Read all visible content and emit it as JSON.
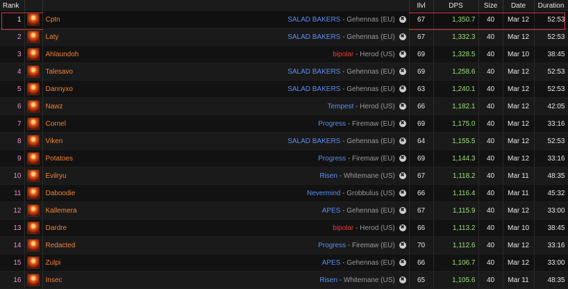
{
  "headers": {
    "rank": "Rank",
    "ilvl": "Ilvl",
    "dps": "DPS",
    "size": "Size",
    "date": "Date",
    "duration": "Duration"
  },
  "colors": {
    "accent_highlight": "#d93b3b",
    "player_name": "#f0823a",
    "dps": "#9be17a",
    "rank": "#e98fd0"
  },
  "rows": [
    {
      "rank": "1",
      "name": "Cptn",
      "guild": "SALAD BAKERS",
      "guild_color": "#5b8ef0",
      "realm": "Gehennas (EU)",
      "ilvl": "67",
      "dps": "1,350.7",
      "size": "40",
      "date": "Mar 12",
      "duration": "52:53"
    },
    {
      "rank": "2",
      "name": "Laty",
      "guild": "SALAD BAKERS",
      "guild_color": "#5b8ef0",
      "realm": "Gehennas (EU)",
      "ilvl": "67",
      "dps": "1,332.3",
      "size": "40",
      "date": "Mar 12",
      "duration": "52:53"
    },
    {
      "rank": "3",
      "name": "Ahlaundoh",
      "guild": "bipolar",
      "guild_color": "#e83a3a",
      "realm": "Herod (US)",
      "ilvl": "69",
      "dps": "1,328.5",
      "size": "40",
      "date": "Mar 10",
      "duration": "38:45"
    },
    {
      "rank": "4",
      "name": "Talesavo",
      "guild": "SALAD BAKERS",
      "guild_color": "#5b8ef0",
      "realm": "Gehennas (EU)",
      "ilvl": "69",
      "dps": "1,258.6",
      "size": "40",
      "date": "Mar 12",
      "duration": "52:53"
    },
    {
      "rank": "5",
      "name": "Dannyxo",
      "guild": "SALAD BAKERS",
      "guild_color": "#5b8ef0",
      "realm": "Gehennas (EU)",
      "ilvl": "63",
      "dps": "1,240.1",
      "size": "40",
      "date": "Mar 12",
      "duration": "52:53"
    },
    {
      "rank": "6",
      "name": "Nawz",
      "guild": "Tempest",
      "guild_color": "#5b8ef0",
      "realm": "Herod (US)",
      "ilvl": "66",
      "dps": "1,182.1",
      "size": "40",
      "date": "Mar 12",
      "duration": "42:05"
    },
    {
      "rank": "7",
      "name": "Cornel",
      "guild": "Progress",
      "guild_color": "#5b8ef0",
      "realm": "Firemaw (EU)",
      "ilvl": "69",
      "dps": "1,175.0",
      "size": "40",
      "date": "Mar 12",
      "duration": "33:16"
    },
    {
      "rank": "8",
      "name": "Viken",
      "guild": "SALAD BAKERS",
      "guild_color": "#5b8ef0",
      "realm": "Gehennas (EU)",
      "ilvl": "64",
      "dps": "1,155.5",
      "size": "40",
      "date": "Mar 12",
      "duration": "52:53"
    },
    {
      "rank": "9",
      "name": "Potatoes",
      "guild": "Progress",
      "guild_color": "#5b8ef0",
      "realm": "Firemaw (EU)",
      "ilvl": "69",
      "dps": "1,144.3",
      "size": "40",
      "date": "Mar 12",
      "duration": "33:16"
    },
    {
      "rank": "10",
      "name": "Evilryu",
      "guild": "Risen",
      "guild_color": "#5b8ef0",
      "realm": "Whitemane (US)",
      "ilvl": "67",
      "dps": "1,118.2",
      "size": "40",
      "date": "Mar 11",
      "duration": "48:35"
    },
    {
      "rank": "11",
      "name": "Daboodie",
      "guild": "Nevermind",
      "guild_color": "#5b8ef0",
      "realm": "Grobbulus (US)",
      "ilvl": "66",
      "dps": "1,116.4",
      "size": "40",
      "date": "Mar 11",
      "duration": "45:32"
    },
    {
      "rank": "12",
      "name": "Kallemera",
      "guild": "APES",
      "guild_color": "#5b8ef0",
      "realm": "Gehennas (EU)",
      "ilvl": "67",
      "dps": "1,115.9",
      "size": "40",
      "date": "Mar 12",
      "duration": "33:00"
    },
    {
      "rank": "13",
      "name": "Dardre",
      "guild": "bipolar",
      "guild_color": "#e83a3a",
      "realm": "Herod (US)",
      "ilvl": "66",
      "dps": "1,113.2",
      "size": "40",
      "date": "Mar 10",
      "duration": "38:45"
    },
    {
      "rank": "14",
      "name": "Redacted",
      "guild": "Progress",
      "guild_color": "#5b8ef0",
      "realm": "Firemaw (EU)",
      "ilvl": "70",
      "dps": "1,112.6",
      "size": "40",
      "date": "Mar 12",
      "duration": "33:16"
    },
    {
      "rank": "15",
      "name": "Zulpi",
      "guild": "APES",
      "guild_color": "#5b8ef0",
      "realm": "Gehennas (EU)",
      "ilvl": "66",
      "dps": "1,106.7",
      "size": "40",
      "date": "Mar 12",
      "duration": "33:00"
    },
    {
      "rank": "16",
      "name": "Insec",
      "guild": "Risen",
      "guild_color": "#5b8ef0",
      "realm": "Whitemane (US)",
      "ilvl": "65",
      "dps": "1,105.6",
      "size": "40",
      "date": "Mar 11",
      "duration": "48:35"
    }
  ],
  "separator": "-",
  "spec_icon": "fire-mage-spec-icon",
  "faction_icon": "horde-faction-icon"
}
